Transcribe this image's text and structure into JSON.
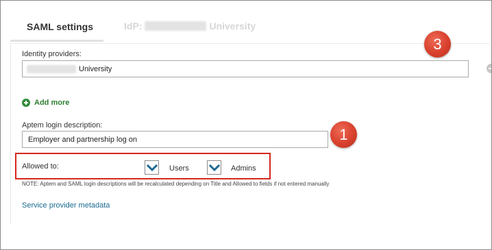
{
  "tabs": {
    "active_label": "SAML settings",
    "idp_prefix": "IdP:",
    "idp_suffix": "University"
  },
  "identity_providers": {
    "label": "Identity providers:",
    "value_suffix": "University"
  },
  "add_more": {
    "label": "Add more"
  },
  "login_description": {
    "label": "Aptem login description:",
    "value": "Employer and partnership log on"
  },
  "allowed_to": {
    "label": "Allowed to:",
    "options": [
      {
        "label": "Users",
        "checked": true
      },
      {
        "label": "Admins",
        "checked": true
      }
    ]
  },
  "note": "NOTE: Aptem and SAML login descriptions will be recalculated depending on Title and Allowed to fields if not entered manually",
  "metadata_link": "Service provider metadata",
  "callouts": {
    "badge_1": "1",
    "badge_3": "3"
  },
  "colors": {
    "highlight_border": "#d6261e",
    "badge_red": "#d8402d",
    "checkbox_blue": "#1f6a93",
    "link_blue": "#1a6a8f",
    "add_green": "#2e8b3c"
  }
}
